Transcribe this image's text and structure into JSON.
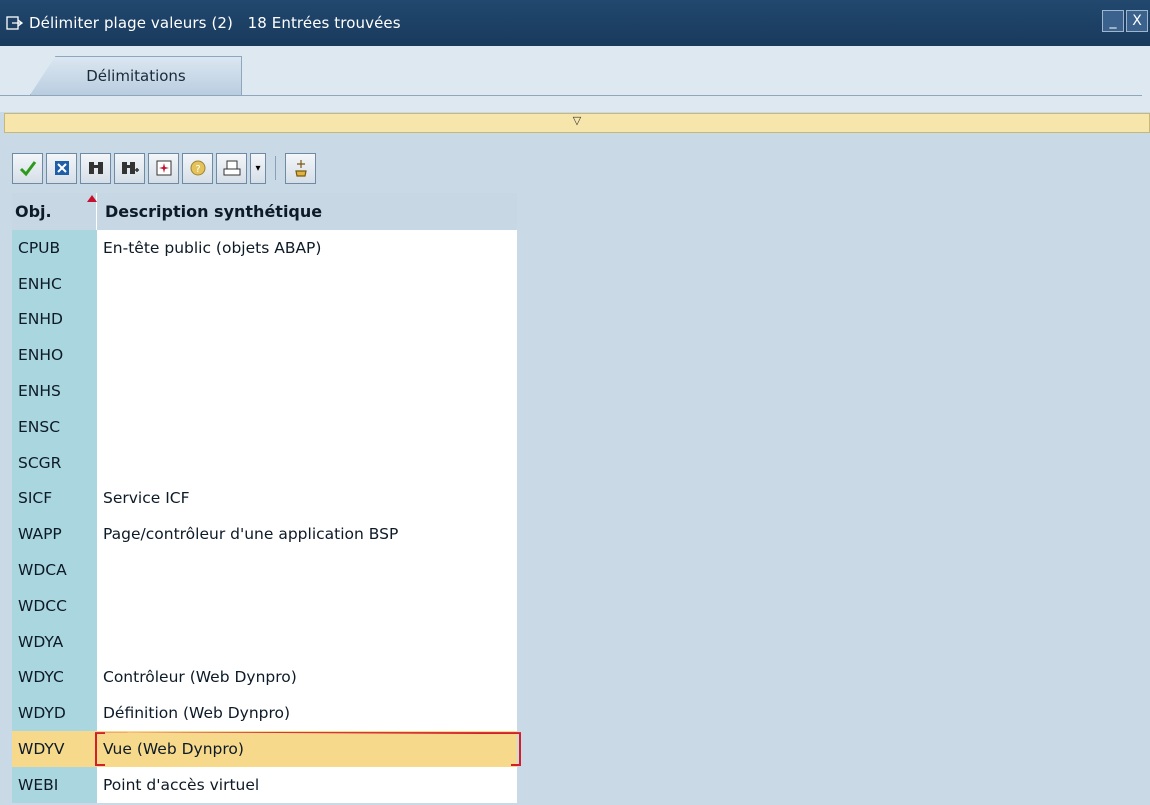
{
  "window": {
    "title": "Délimiter plage valeurs (2)   18 Entrées trouvées",
    "minimize_label": "_",
    "close_label": "X"
  },
  "tabs": [
    {
      "label": "Délimitations"
    }
  ],
  "collapse_icon": "▽",
  "toolbar": {
    "buttons": [
      {
        "icon": "check-icon"
      },
      {
        "icon": "cancel-icon"
      },
      {
        "icon": "find-icon"
      },
      {
        "icon": "find-next-icon"
      },
      {
        "icon": "new-selection-icon"
      },
      {
        "icon": "help-icon"
      },
      {
        "icon": "print-icon"
      },
      {
        "icon": "dropdown-arrow-icon"
      },
      {
        "icon": "personalize-icon"
      }
    ]
  },
  "table": {
    "headers": {
      "obj": "Obj.",
      "desc": "Description synthétique"
    },
    "rows": [
      {
        "obj": "CPUB",
        "desc": "En-tête public (objets ABAP)"
      },
      {
        "obj": "ENHC",
        "desc": ""
      },
      {
        "obj": "ENHD",
        "desc": ""
      },
      {
        "obj": "ENHO",
        "desc": ""
      },
      {
        "obj": "ENHS",
        "desc": ""
      },
      {
        "obj": "ENSC",
        "desc": ""
      },
      {
        "obj": "SCGR",
        "desc": ""
      },
      {
        "obj": "SICF",
        "desc": "Service ICF"
      },
      {
        "obj": "WAPP",
        "desc": "Page/contrôleur d'une application BSP"
      },
      {
        "obj": "WDCA",
        "desc": ""
      },
      {
        "obj": "WDCC",
        "desc": ""
      },
      {
        "obj": "WDYA",
        "desc": ""
      },
      {
        "obj": "WDYC",
        "desc": "Contrôleur (Web Dynpro)"
      },
      {
        "obj": "WDYD",
        "desc": "Définition (Web Dynpro)"
      },
      {
        "obj": "WDYV",
        "desc": "Vue (Web Dynpro)"
      },
      {
        "obj": "WEBI",
        "desc": "Point d'accès virtuel"
      }
    ],
    "selected_index": 14
  },
  "colors": {
    "titlebar": "#1d4266",
    "obj_column": "#aad6df",
    "selected_row": "#f7d98b",
    "background": "#c9d9e6"
  }
}
